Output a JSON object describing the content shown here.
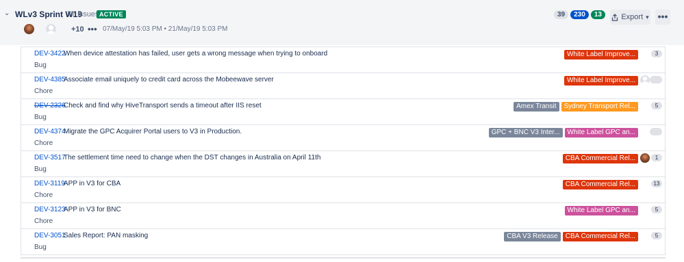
{
  "sprint": {
    "name": "WLv3 Sprint W19",
    "issue_count": "77 issues",
    "status": "ACTIVE",
    "todo_count": "39",
    "in_progress_count": "230",
    "done_count": "13",
    "export_label": "Export",
    "more_label": "•••",
    "extra_participants": "+10",
    "participants_more": "•••",
    "dates": "07/May/19 5:03 PM • 21/May/19 5:03 PM"
  },
  "colors": {
    "white_label_improve": "#de350b",
    "white_label_gpc": "#cd519d",
    "sydney_transport": "#ff991f",
    "cba_commercial": "#de350b",
    "neutral_label": "#7a869a"
  },
  "issues": [
    {
      "key": "DEV-3422",
      "summary": "When device attestation has failed, user gets a wrong message when trying to onboard",
      "type": "Bug",
      "labels": [],
      "epic": "White Label Improve...",
      "estimate": "3"
    },
    {
      "key": "DEV-4385",
      "summary": "Associate email uniquely to credit card across the Mobeewave server",
      "type": "Chore",
      "labels": [],
      "epic": "White Label Improve...",
      "estimate": ""
    },
    {
      "key": "DEV-2326",
      "summary": "Check and find why HiveTransport sends a timeout after IIS reset",
      "type": "Bug",
      "labels": [
        "Amex Transit"
      ],
      "epic": "Sydney Transport Rel...",
      "estimate": "5"
    },
    {
      "key": "DEV-4374",
      "summary": "Migrate the GPC Acquirer Portal users to V3 in Production.",
      "type": "Chore",
      "labels": [
        "GPC + BNC V3 Inter..."
      ],
      "epic": "White Label GPC an...",
      "estimate": ""
    },
    {
      "key": "DEV-3517",
      "summary": "The settlement time need to change when the DST changes in Australia on April 11th",
      "type": "Bug",
      "labels": [],
      "epic": "CBA Commercial Rel...",
      "estimate": "1"
    },
    {
      "key": "DEV-3119",
      "summary": "APP in V3 for CBA",
      "type": "Chore",
      "labels": [],
      "epic": "CBA Commercial Rel...",
      "estimate": "13"
    },
    {
      "key": "DEV-3123",
      "summary": "APP in V3 for BNC",
      "type": "Chore",
      "labels": [],
      "epic": "White Label GPC an...",
      "estimate": "5"
    },
    {
      "key": "DEV-3051",
      "summary": "Sales Report: PAN masking",
      "type": "Bug",
      "labels": [
        "CBA V3 Release"
      ],
      "epic": "CBA Commercial Rel...",
      "estimate": "5"
    }
  ]
}
